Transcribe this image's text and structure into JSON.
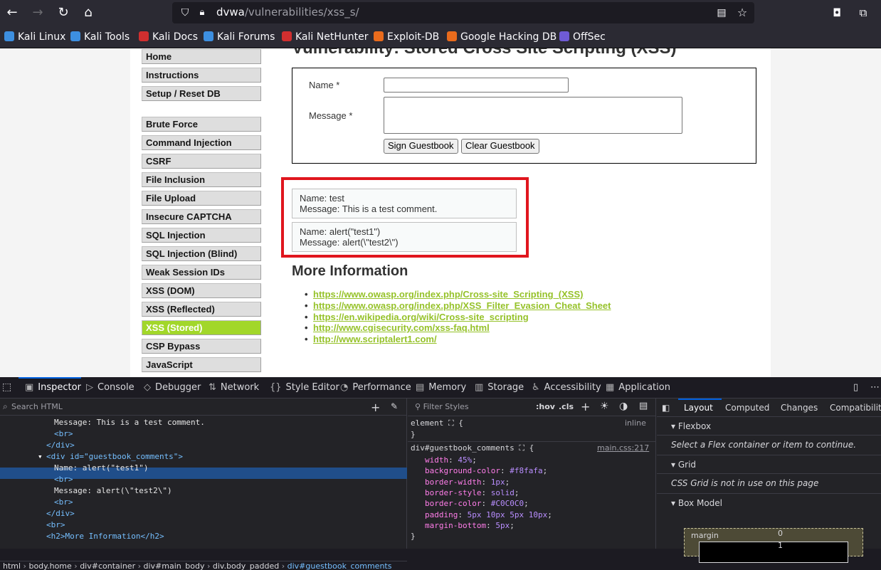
{
  "browser": {
    "url_host": "dvwa",
    "url_path": "/vulnerabilities/xss_s/"
  },
  "bookmarks": [
    {
      "label": "Kali Linux",
      "color": "#3d8fe0"
    },
    {
      "label": "Kali Tools",
      "color": "#3d8fe0"
    },
    {
      "label": "Kali Docs",
      "color": "#d12f2f"
    },
    {
      "label": "Kali Forums",
      "color": "#3d8fe0"
    },
    {
      "label": "Kali NetHunter",
      "color": "#d12f2f"
    },
    {
      "label": "Exploit-DB",
      "color": "#e96b1c"
    },
    {
      "label": "Google Hacking DB",
      "color": "#e96b1c"
    },
    {
      "label": "OffSec",
      "color": "#6f5bd5"
    }
  ],
  "dvwa": {
    "title": "Vulnerability: Stored Cross Site Scripting (XSS)",
    "menu_top": [
      "Home",
      "Instructions",
      "Setup / Reset DB"
    ],
    "menu_vulns": [
      "Brute Force",
      "Command Injection",
      "CSRF",
      "File Inclusion",
      "File Upload",
      "Insecure CAPTCHA",
      "SQL Injection",
      "SQL Injection (Blind)",
      "Weak Session IDs",
      "XSS (DOM)",
      "XSS (Reflected)",
      "XSS (Stored)",
      "CSP Bypass",
      "JavaScript"
    ],
    "selected": "XSS (Stored)",
    "form": {
      "name_label": "Name *",
      "message_label": "Message *",
      "name_value": "",
      "message_value": "",
      "sign_button": "Sign Guestbook",
      "clear_button": "Clear Guestbook"
    },
    "comments": [
      {
        "name": "Name: test",
        "message": "Message: This is a test comment."
      },
      {
        "name": "Name: alert(\"test1\")",
        "message": "Message: alert(\\\"test2\\\")"
      }
    ],
    "more_info_title": "More Information",
    "links": [
      "https://www.owasp.org/index.php/Cross-site_Scripting_(XSS)",
      "https://www.owasp.org/index.php/XSS_Filter_Evasion_Cheat_Sheet",
      "https://en.wikipedia.org/wiki/Cross-site_scripting",
      "http://www.cgisecurity.com/xss-faq.html",
      "http://www.scriptalert1.com/"
    ]
  },
  "devtools": {
    "tabs": [
      {
        "label": "Inspector",
        "glyph": "▣"
      },
      {
        "label": "Console",
        "glyph": "▷"
      },
      {
        "label": "Debugger",
        "glyph": "◇"
      },
      {
        "label": "Network",
        "glyph": "⇅"
      },
      {
        "label": "Style Editor",
        "glyph": "{}"
      },
      {
        "label": "Performance",
        "glyph": "◔"
      },
      {
        "label": "Memory",
        "glyph": "▤"
      },
      {
        "label": "Storage",
        "glyph": "▥"
      },
      {
        "label": "Accessibility",
        "glyph": "♿"
      },
      {
        "label": "Application",
        "glyph": "▦"
      }
    ],
    "search_placeholder": "Search HTML",
    "html_lines": [
      "Message: This is a test comment.",
      "<br>",
      "</div>",
      "<div id=\"guestbook_comments\">",
      "Name: alert(\"test1\")",
      "<br>",
      "Message: alert(\\\"test2\\\")",
      "<br>",
      "</div>",
      "<br>",
      "<h2>More Information</h2>"
    ],
    "breadcrumbs": [
      "html",
      "body.home",
      "div#container",
      "div#main_body",
      "div.body_padded",
      "div#guestbook_comments"
    ],
    "styles": {
      "filter_placeholder": "Filter Styles",
      "hov": ":hov",
      "cls": ".cls",
      "element_rule": "element",
      "element_source": "inline",
      "selector": "div#guestbook_comments",
      "source": "main.css:217",
      "props": [
        {
          "name": "width",
          "value": "45%"
        },
        {
          "name": "background-color",
          "value": "#f8fafa"
        },
        {
          "name": "border-width",
          "value": "1px"
        },
        {
          "name": "border-style",
          "value": "solid"
        },
        {
          "name": "border-color",
          "value": "#C0C0C0"
        },
        {
          "name": "padding",
          "value": "5px 10px 5px 10px"
        },
        {
          "name": "margin-bottom",
          "value": "5px"
        }
      ]
    },
    "layout": {
      "tabs": [
        "Layout",
        "Computed",
        "Changes",
        "Compatibility"
      ],
      "flexbox_title": "Flexbox",
      "flexbox_msg": "Select a Flex container or item to continue.",
      "grid_title": "Grid",
      "grid_msg": "CSS Grid is not in use on this page",
      "boxmodel_title": "Box Model",
      "margin_label": "margin",
      "margin_top": "0",
      "border_value": "1"
    }
  }
}
